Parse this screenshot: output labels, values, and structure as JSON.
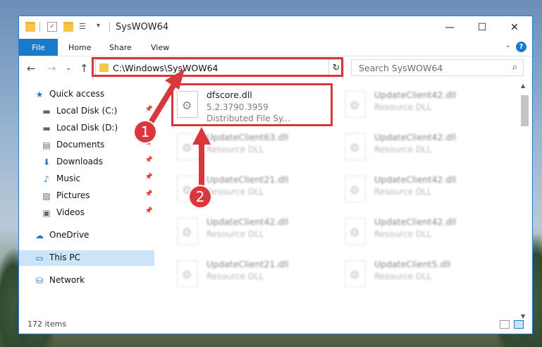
{
  "window": {
    "title": "SysWOW64",
    "controls": {
      "minimize": "—",
      "maximize": "☐",
      "close": "✕"
    }
  },
  "ribbon": {
    "file_tab": "File",
    "tabs": [
      "Home",
      "Share",
      "View"
    ],
    "help": "?"
  },
  "address_bar": {
    "path": "C:\\Windows\\SysWOW64",
    "refresh_icon": "refresh-icon"
  },
  "search": {
    "placeholder": "Search SysWOW64"
  },
  "sidebar": {
    "items": [
      {
        "label": "Quick access",
        "icon": "star-icon",
        "pinned": false
      },
      {
        "label": "Local Disk (C:)",
        "icon": "drive-icon",
        "pinned": true
      },
      {
        "label": "Local Disk (D:)",
        "icon": "drive-icon",
        "pinned": false
      },
      {
        "label": "Documents",
        "icon": "documents-icon",
        "pinned": true
      },
      {
        "label": "Downloads",
        "icon": "download-icon",
        "pinned": true
      },
      {
        "label": "Music",
        "icon": "music-icon",
        "pinned": true
      },
      {
        "label": "Pictures",
        "icon": "pictures-icon",
        "pinned": true
      },
      {
        "label": "Videos",
        "icon": "videos-icon",
        "pinned": true
      },
      {
        "label": "OneDrive",
        "icon": "cloud-icon",
        "pinned": false
      },
      {
        "label": "This PC",
        "icon": "pc-icon",
        "pinned": false,
        "selected": true
      },
      {
        "label": "Network",
        "icon": "network-icon",
        "pinned": false
      }
    ]
  },
  "files": {
    "highlighted": {
      "name": "dfscore.dll",
      "version": "5.2.3790.3959",
      "description": "Distributed File Sy..."
    },
    "tiles": [
      {
        "name": "UpdateClient42.dll",
        "type": "Resource DLL"
      },
      {
        "name": "UpdateClient63.dll",
        "type": "Resource DLL"
      },
      {
        "name": "UpdateClient42.dll",
        "type": "Resource DLL"
      },
      {
        "name": "UpdateClient21.dll",
        "type": "Resource DLL"
      },
      {
        "name": "UpdateClient42.dll",
        "type": "Resource DLL"
      },
      {
        "name": "UpdateClient42.dll",
        "type": "Resource DLL"
      },
      {
        "name": "UpdateClient42.dll",
        "type": "Resource DLL"
      },
      {
        "name": "UpdateClient21.dll",
        "type": "Resource DLL"
      },
      {
        "name": "UpdateClient5.dll",
        "type": "Resource DLL"
      }
    ]
  },
  "status": {
    "count": "172 items"
  },
  "annotations": {
    "step1": "1",
    "step2": "2",
    "color": "#d9363e"
  }
}
